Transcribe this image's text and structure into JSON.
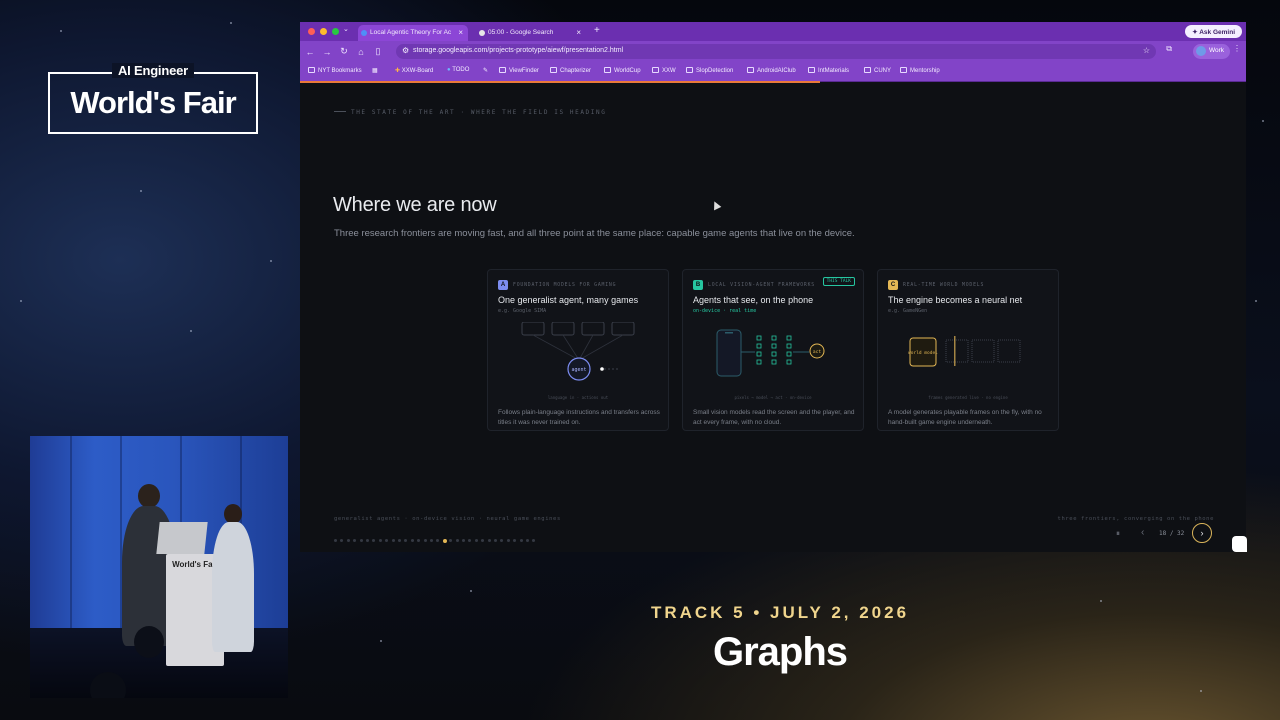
{
  "event": {
    "logo_top": "AI Engineer",
    "logo_main": "World's Fair"
  },
  "podium_text": "World's Fair",
  "browser": {
    "tabs": [
      {
        "label": "Local Agentic Theory For Ac",
        "active": true
      },
      {
        "label": "05:00 - Google Search",
        "active": false
      }
    ],
    "new_tab": "+",
    "ask_gemini": "Ask Gemini",
    "url": "storage.googleapis.com/projects-prototype/aiewf/presentation2.html",
    "profile": "Work",
    "bookmarks": [
      "NYT Bookmarks",
      "XXW-Board",
      "TODO",
      "ViewFinder",
      "Chapterizer",
      "WorldCup",
      "XXW",
      "SlopDetection",
      "AndroidAIClub",
      "IntMaterials",
      "CUNY",
      "Mentorship"
    ]
  },
  "slide": {
    "eyebrow": "THE STATE OF THE ART · WHERE THE FIELD IS HEADING",
    "title": "Where we are now",
    "subtitle": "Three research frontiers are moving fast, and all three point at the same place: capable game agents that live on the device.",
    "cards": [
      {
        "badge": "A",
        "badge_color": "#7c8cf0",
        "tag": "FOUNDATION MODELS FOR GAMING",
        "title": "One generalist agent, many games",
        "example": "e.g. Google SIMA",
        "agent_label": "agent",
        "caption": "language in · actions out",
        "desc": "Follows plain-language instructions and transfers across titles it was never trained on."
      },
      {
        "badge": "B",
        "badge_color": "#26c6a0",
        "tag": "LOCAL VISION-AGENT FRAMEWORKS",
        "this_talk": "THIS TALK",
        "title": "Agents that see, on the phone",
        "example": "on-device · real time",
        "act_label": "act",
        "caption": "pixels → model → act · on-device",
        "desc": "Small vision models read the screen and the player, and act every frame, with no cloud."
      },
      {
        "badge": "C",
        "badge_color": "#e3b755",
        "tag": "REAL-TIME WORLD MODELS",
        "title": "The engine becomes a neural net",
        "example": "e.g. GameNGen",
        "world_label": "world model",
        "caption": "frames generated live · no engine",
        "desc": "A model generates playable frames on the fly, with no hand-built game engine underneath."
      }
    ],
    "footer_left": "generalist agents · on-device vision · neural game engines",
    "footer_right": "three frontiers, converging on the phone",
    "progress_total": 32,
    "progress_current": 18,
    "counter": "18 / 32",
    "pause_icon": "⏸",
    "prev_icon": "‹",
    "next_icon": "›"
  },
  "caption": {
    "track": "TRACK 5 • JULY 2, 2026",
    "topic": "Graphs"
  }
}
